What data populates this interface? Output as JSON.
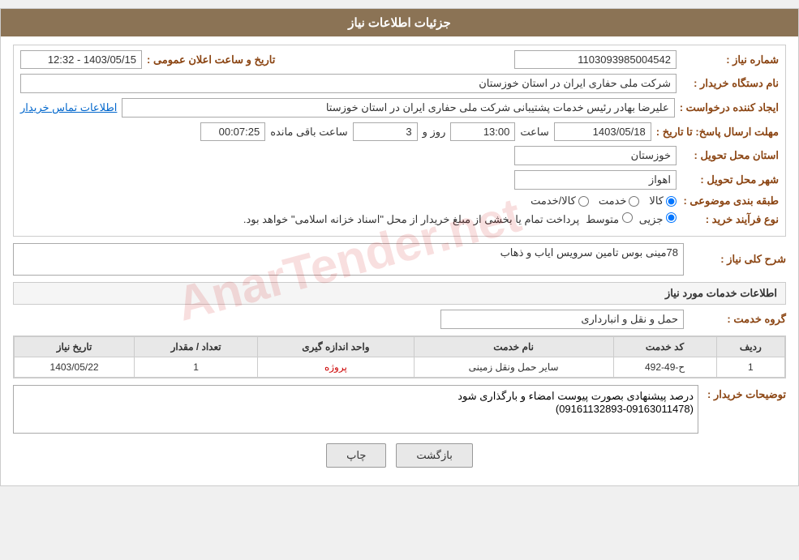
{
  "header": {
    "title": "جزئیات اطلاعات نیاز"
  },
  "fields": {
    "need_number_label": "شماره نیاز :",
    "need_number_value": "1103093985004542",
    "buyer_org_label": "نام دستگاه خریدار :",
    "buyer_org_value": "شرکت ملی حفاری ایران در استان خوزستان",
    "creator_label": "ایجاد کننده درخواست :",
    "creator_value": "علیرضا بهادر رئیس خدمات پشتیبانی شرکت ملی حفاری ایران در استان خوزستا",
    "contact_link": "اطلاعات تماس خریدار",
    "announce_datetime_label": "تاریخ و ساعت اعلان عمومی :",
    "announce_datetime_value": "1403/05/15 - 12:32",
    "reply_deadline_label": "مهلت ارسال پاسخ: تا تاریخ :",
    "reply_date": "1403/05/18",
    "reply_time_label": "ساعت",
    "reply_time": "13:00",
    "reply_days_label": "روز و",
    "reply_days": "3",
    "remaining_label": "ساعت باقی مانده",
    "remaining_time": "00:07:25",
    "province_label": "استان محل تحویل :",
    "province_value": "خوزستان",
    "city_label": "شهر محل تحویل :",
    "city_value": "اهواز",
    "category_label": "طبقه بندی موضوعی :",
    "category_options": [
      "کالا",
      "خدمت",
      "کالا/خدمت"
    ],
    "category_selected": "کالا",
    "purchase_type_label": "نوع فرآیند خرید :",
    "purchase_type_options": [
      "جزیی",
      "متوسط"
    ],
    "purchase_type_note": "پرداخت تمام یا بخشی از مبلغ خریدار از محل \"اسناد خزانه اسلامی\" خواهد بود.",
    "need_description_label": "شرح کلی نیاز :",
    "need_description_value": "78مینی بوس تامین سرویس ایاب و ذهاب",
    "services_section_title": "اطلاعات خدمات مورد نیاز",
    "service_group_label": "گروه خدمت :",
    "service_group_value": "حمل و نقل و انبارداری",
    "table": {
      "headers": [
        "ردیف",
        "کد خدمت",
        "نام خدمت",
        "واحد اندازه گیری",
        "تعداد / مقدار",
        "تاریخ نیاز"
      ],
      "rows": [
        {
          "row": "1",
          "code": "ح-49-492",
          "name": "سایر حمل ونقل زمینی",
          "unit": "پروژه",
          "quantity": "1",
          "date": "1403/05/22"
        }
      ]
    },
    "buyer_notes_label": "توضیحات خریدار :",
    "buyer_notes_value": "درصد پیشنهادی بصورت پیوست امضاء و بارگذاری شود\n(09161132893-09163011478)"
  },
  "buttons": {
    "print": "چاپ",
    "back": "بازگشت"
  }
}
